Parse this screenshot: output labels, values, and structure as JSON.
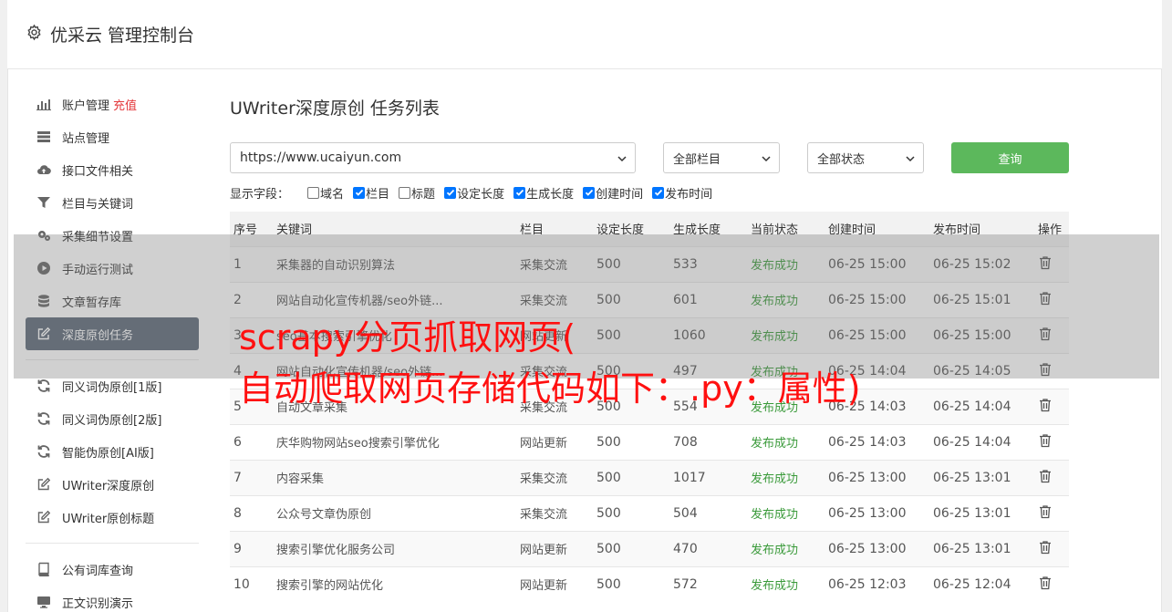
{
  "brand": {
    "title": "优采云 管理控制台",
    "icon": "gear-icon"
  },
  "sidebar": {
    "items": [
      {
        "label": "账户管理",
        "extra": "充值",
        "icon": "bar-chart-icon"
      },
      {
        "label": "站点管理",
        "icon": "server-icon"
      },
      {
        "label": "接口文件相关",
        "icon": "cloud-upload-icon"
      },
      {
        "label": "栏目与关键词",
        "icon": "filter-icon"
      },
      {
        "label": "采集细节设置",
        "icon": "gears-icon"
      },
      {
        "label": "手动运行测试",
        "icon": "play-icon"
      },
      {
        "label": "文章暂存库",
        "icon": "database-icon"
      },
      {
        "label": "深度原创任务",
        "icon": "edit-icon",
        "active": true
      },
      {
        "label": "同义词伪原创[1版]",
        "icon": "refresh-icon"
      },
      {
        "label": "同义词伪原创[2版]",
        "icon": "refresh-icon"
      },
      {
        "label": "智能伪原创[AI版]",
        "icon": "refresh-icon"
      },
      {
        "label": "UWriter深度原创",
        "icon": "edit-icon"
      },
      {
        "label": "UWriter原创标题",
        "icon": "edit-icon"
      },
      {
        "label": "公有词库查询",
        "icon": "book-icon"
      },
      {
        "label": "正文识别演示",
        "icon": "monitor-icon"
      }
    ]
  },
  "main": {
    "title": "UWriter深度原创 任务列表",
    "site_select": "https://www.ucaiyun.com",
    "column_select": "全部栏目",
    "status_select": "全部状态",
    "query_button": "查询",
    "fields_label": "显示字段：",
    "fields": [
      {
        "label": "域名",
        "checked": false
      },
      {
        "label": "栏目",
        "checked": true
      },
      {
        "label": "标题",
        "checked": false
      },
      {
        "label": "设定长度",
        "checked": true
      },
      {
        "label": "生成长度",
        "checked": true
      },
      {
        "label": "创建时间",
        "checked": true
      },
      {
        "label": "发布时间",
        "checked": true
      }
    ],
    "table": {
      "headers": [
        "序号",
        "关键词",
        "栏目",
        "设定长度",
        "生成长度",
        "当前状态",
        "创建时间",
        "发布时间",
        "操作"
      ],
      "rows": [
        [
          "1",
          "采集器的自动识别算法",
          "采集交流",
          "500",
          "533",
          "发布成功",
          "06-25 15:00",
          "06-25 15:02"
        ],
        [
          "2",
          "网站自动化宣传机器/seo外链...",
          "采集交流",
          "500",
          "601",
          "发布成功",
          "06-25 15:00",
          "06-25 15:01"
        ],
        [
          "3",
          "seo基本搜索引擎优化",
          "网站更新",
          "500",
          "1060",
          "发布成功",
          "06-25 15:00",
          "06-25 15:00"
        ],
        [
          "4",
          "网站自动化宣传机器/seo外链...",
          "采集交流",
          "500",
          "497",
          "发布成功",
          "06-25 14:04",
          "06-25 14:05"
        ],
        [
          "5",
          "自动文章采集",
          "采集交流",
          "500",
          "554",
          "发布成功",
          "06-25 14:03",
          "06-25 14:04"
        ],
        [
          "6",
          "庆华购物网站seo搜索引擎优化",
          "网站更新",
          "500",
          "708",
          "发布成功",
          "06-25 14:03",
          "06-25 14:04"
        ],
        [
          "7",
          "内容采集",
          "采集交流",
          "500",
          "1017",
          "发布成功",
          "06-25 13:00",
          "06-25 13:01"
        ],
        [
          "8",
          "公众号文章伪原创",
          "采集交流",
          "500",
          "504",
          "发布成功",
          "06-25 13:00",
          "06-25 13:01"
        ],
        [
          "9",
          "搜索引擎优化服务公司",
          "网站更新",
          "500",
          "470",
          "发布成功",
          "06-25 13:00",
          "06-25 13:01"
        ],
        [
          "10",
          "搜索引擎的网站优化",
          "网站更新",
          "500",
          "572",
          "发布成功",
          "06-25 12:03",
          "06-25 12:04"
        ]
      ]
    }
  },
  "overlay": {
    "line1": "scrapy分页抓取网页(",
    "line2": "自动爬取网页存储代码如下：.py：属性)"
  },
  "colors": {
    "accent": "#5cb85c",
    "active_nav": "#5b6877",
    "success": "#3a9a3a",
    "caption": "#ff1010"
  }
}
